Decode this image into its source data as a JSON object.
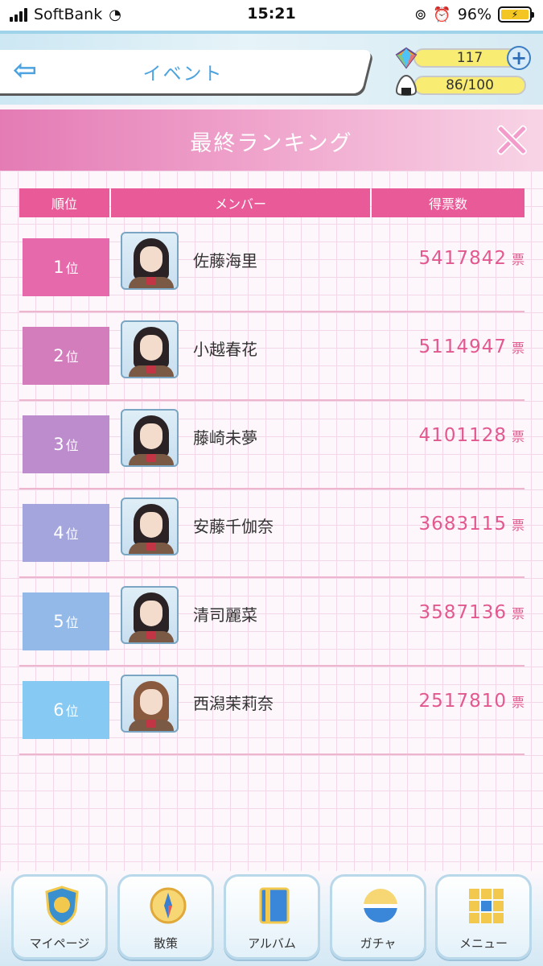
{
  "status_bar": {
    "carrier": "SoftBank",
    "time": "15:21",
    "battery": "96%"
  },
  "header": {
    "title": "イベント",
    "gems": "117",
    "stamina": "86/100"
  },
  "section": {
    "title": "最終ランキング"
  },
  "table": {
    "headers": {
      "rank": "順位",
      "member": "メンバー",
      "votes": "得票数"
    },
    "vote_unit": "票",
    "rows": [
      {
        "rank": "1",
        "rank_unit": "位",
        "name": "佐藤海里",
        "votes": "5417842",
        "color": "#e669ab"
      },
      {
        "rank": "2",
        "rank_unit": "位",
        "name": "小越春花",
        "votes": "5114947",
        "color": "#d47dbd"
      },
      {
        "rank": "3",
        "rank_unit": "位",
        "name": "藤崎未夢",
        "votes": "4101128",
        "color": "#bc8ccc"
      },
      {
        "rank": "4",
        "rank_unit": "位",
        "name": "安藤千伽奈",
        "votes": "3683115",
        "color": "#a3a5dc"
      },
      {
        "rank": "5",
        "rank_unit": "位",
        "name": "清司麗菜",
        "votes": "3587136",
        "color": "#93b9e8"
      },
      {
        "rank": "6",
        "rank_unit": "位",
        "name": "西潟茉莉奈",
        "votes": "2517810",
        "color": "#86c9f2"
      }
    ]
  },
  "nav": {
    "items": [
      {
        "label": "マイページ",
        "icon": "ngt48-emblem-icon"
      },
      {
        "label": "散策",
        "icon": "compass-icon"
      },
      {
        "label": "アルバム",
        "icon": "album-icon"
      },
      {
        "label": "ガチャ",
        "icon": "gacha-capsule-icon"
      },
      {
        "label": "メニュー",
        "icon": "menu-grid-icon"
      }
    ]
  }
}
